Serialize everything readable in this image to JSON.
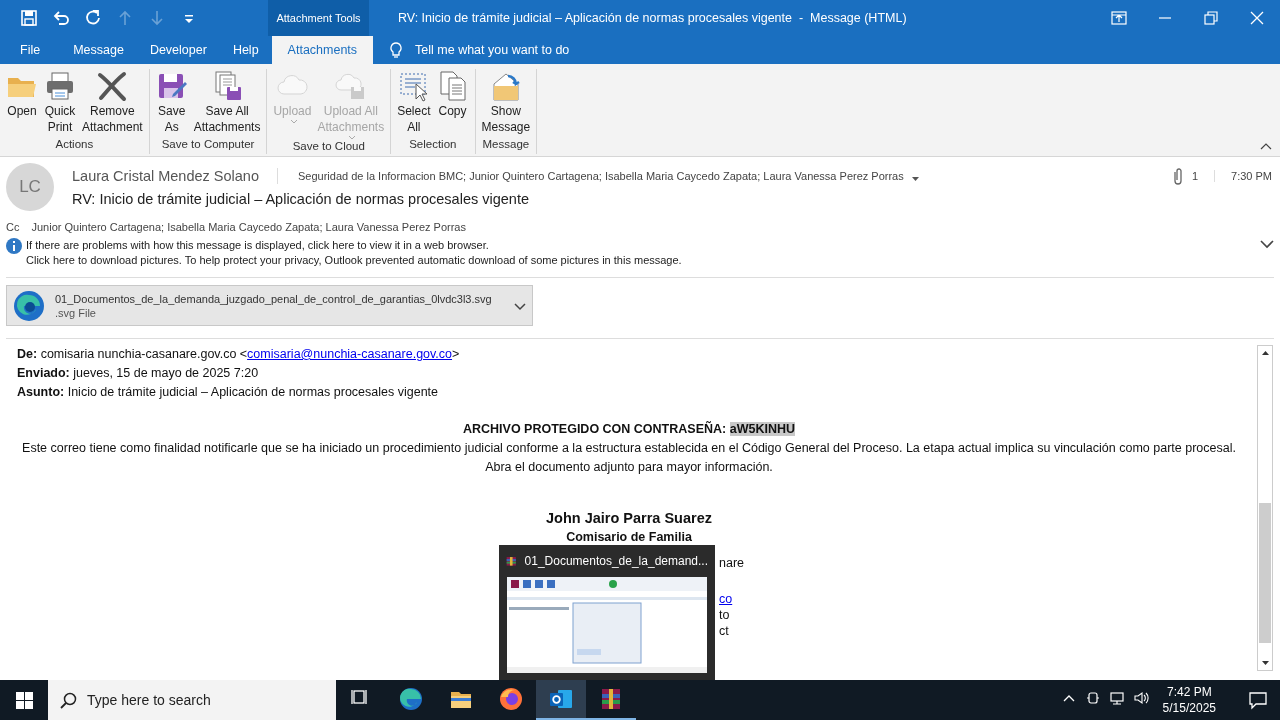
{
  "quick_access": [
    {
      "kind": "save",
      "disabled": false
    },
    {
      "kind": "undo",
      "disabled": false
    },
    {
      "kind": "redo",
      "disabled": false
    },
    {
      "kind": "up",
      "disabled": true
    },
    {
      "kind": "down",
      "disabled": true
    },
    {
      "kind": "customize",
      "disabled": false
    }
  ],
  "context_tab": "Attachment Tools",
  "window": {
    "title": "RV: Inicio de trámite judicial – Aplicación de normas procesales vigente  -  Message (HTML)"
  },
  "menu_tabs": [
    {
      "label": "File",
      "selected": false
    },
    {
      "label": "Message",
      "selected": false
    },
    {
      "label": "Developer",
      "selected": false
    },
    {
      "label": "Help",
      "selected": false
    },
    {
      "label": "Attachments",
      "selected": true
    }
  ],
  "tell_me": {
    "placeholder": "Tell me what you want to do"
  },
  "ribbon_groups": [
    {
      "label": "Actions",
      "buttons": [
        {
          "label": "Open",
          "kind": "folder",
          "disabled": false,
          "dropdown": false
        },
        {
          "label": "Quick\nPrint",
          "kind": "printer",
          "disabled": false,
          "dropdown": false
        },
        {
          "label": "Remove\nAttachment",
          "kind": "remove",
          "disabled": false,
          "dropdown": false
        }
      ]
    },
    {
      "label": "Save to Computer",
      "buttons": [
        {
          "label": "Save\nAs",
          "kind": "saveas",
          "disabled": false,
          "dropdown": false
        },
        {
          "label": "Save All\nAttachments",
          "kind": "saveall",
          "disabled": false,
          "dropdown": false
        }
      ]
    },
    {
      "label": "Save to Cloud",
      "buttons": [
        {
          "label": "Upload",
          "kind": "cloud",
          "disabled": true,
          "dropdown": true
        },
        {
          "label": "Upload All\nAttachments",
          "kind": "cloudall",
          "disabled": true,
          "dropdown": true
        }
      ]
    },
    {
      "label": "Selection",
      "buttons": [
        {
          "label": "Select\nAll",
          "kind": "select",
          "disabled": false,
          "dropdown": false
        },
        {
          "label": "Copy",
          "kind": "copy",
          "disabled": false,
          "dropdown": false
        }
      ]
    },
    {
      "label": "Message",
      "buttons": [
        {
          "label": "Show\nMessage",
          "kind": "message",
          "disabled": false,
          "dropdown": false
        }
      ]
    }
  ],
  "header": {
    "avatar": "LC",
    "sender": "Laura Cristal Mendez Solano",
    "recipients": "Seguridad de la Informacion BMC; Junior Quintero Cartagena; Isabella Maria Caycedo Zapata; Laura Vanessa Perez Porras",
    "attachment_count": "1",
    "time": "7:30 PM",
    "subject": "RV: Inicio de trámite judicial – Aplicación de normas procesales vigente",
    "cc_label": "Cc",
    "cc": "Junior Quintero Cartagena; Isabella Maria Caycedo Zapata; Laura Vanessa Perez Porras",
    "info": [
      "If there are problems with how this message is displayed, click here to view it in a web browser.",
      "Click here to download pictures. To help protect your privacy, Outlook prevented automatic download of some pictures in this message."
    ]
  },
  "attachment": {
    "name": "01_Documentos_de_la_demanda_juzgado_penal_de_control_de_garantias_0lvdc3l3.svg",
    "type": ".svg File"
  },
  "body": {
    "from": {
      "text": "**De:** comisaria nunchia-casanare.gov.co <",
      "link": "comisaria@nunchia-casanare.gov.co",
      "after": ">"
    },
    "sent": "**Enviado:** jueves, 15 de mayo de 2025  7:20",
    "subject": "**Asunto:** Inicio de trámite judicial – Aplicación de normas procesales vigente",
    "password": {
      "text": "ARCHIVO PROTEGIDO CON CONTRASEÑA: ",
      "value": "aW5KINHU"
    },
    "paragraphs": [
      "Este correo tiene como finalidad notificarle que se ha iniciado un procedimiento judicial conforme a la estructura establecida en el Código General del Proceso. La etapa actual implica su vinculación como parte procesal.",
      "Abra el documento adjunto para mayor información."
    ],
    "signature_name": "John Jairo Parra Suarez",
    "signature_title": "Comisario de Familia",
    "fragments": [
      {
        "text": "nare",
        "kind": "text"
      },
      {
        "text": "co",
        "kind": "link"
      },
      {
        "text": "to",
        "kind": "text"
      },
      {
        "text": "ct",
        "kind": "text"
      }
    ]
  },
  "thumbnail_popup": {
    "title": "01_Documentos_de_la_demand..."
  },
  "taskbar": {
    "search": {
      "placeholder": "Type here to search"
    },
    "apps": [
      {
        "kind": "taskview",
        "running": false,
        "selected": false
      },
      {
        "kind": "edge",
        "running": false,
        "selected": false
      },
      {
        "kind": "explorer",
        "running": false,
        "selected": false
      },
      {
        "kind": "firefox",
        "running": false,
        "selected": false
      },
      {
        "kind": "outlook",
        "running": true,
        "selected": true
      },
      {
        "kind": "winrar",
        "running": true,
        "selected": false
      }
    ],
    "time": "7:42 PM",
    "date": "5/15/2025"
  }
}
